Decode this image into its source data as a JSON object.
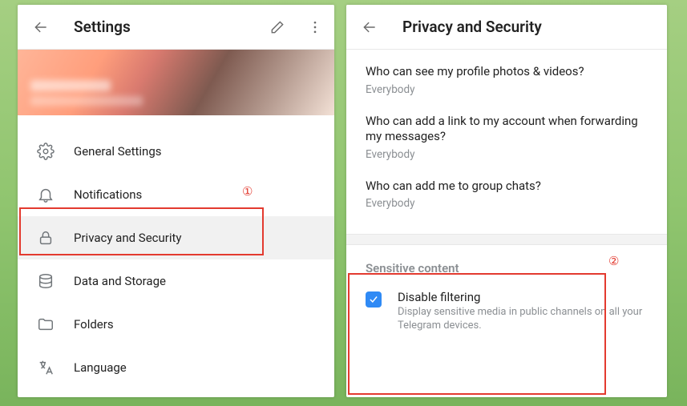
{
  "settings": {
    "title": "Settings",
    "menu": [
      {
        "icon": "gear",
        "label": "General Settings"
      },
      {
        "icon": "bell",
        "label": "Notifications"
      },
      {
        "icon": "lock",
        "label": "Privacy and Security"
      },
      {
        "icon": "data",
        "label": "Data and Storage"
      },
      {
        "icon": "folder",
        "label": "Folders"
      },
      {
        "icon": "lang",
        "label": "Language"
      }
    ]
  },
  "privacy": {
    "title": "Privacy and Security",
    "items": [
      {
        "q": "Who can see my profile photos & videos?",
        "a": "Everybody"
      },
      {
        "q": "Who can add a link to my account when forwarding my messages?",
        "a": "Everybody"
      },
      {
        "q": "Who can add me to group chats?",
        "a": "Everybody"
      }
    ],
    "sensitive_header": "Sensitive content",
    "disable_filtering_label": "Disable filtering",
    "disable_filtering_desc": "Display sensitive media in public channels on all your Telegram devices.",
    "disable_filtering_checked": true
  },
  "annotations": {
    "one": "①",
    "two": "②"
  }
}
